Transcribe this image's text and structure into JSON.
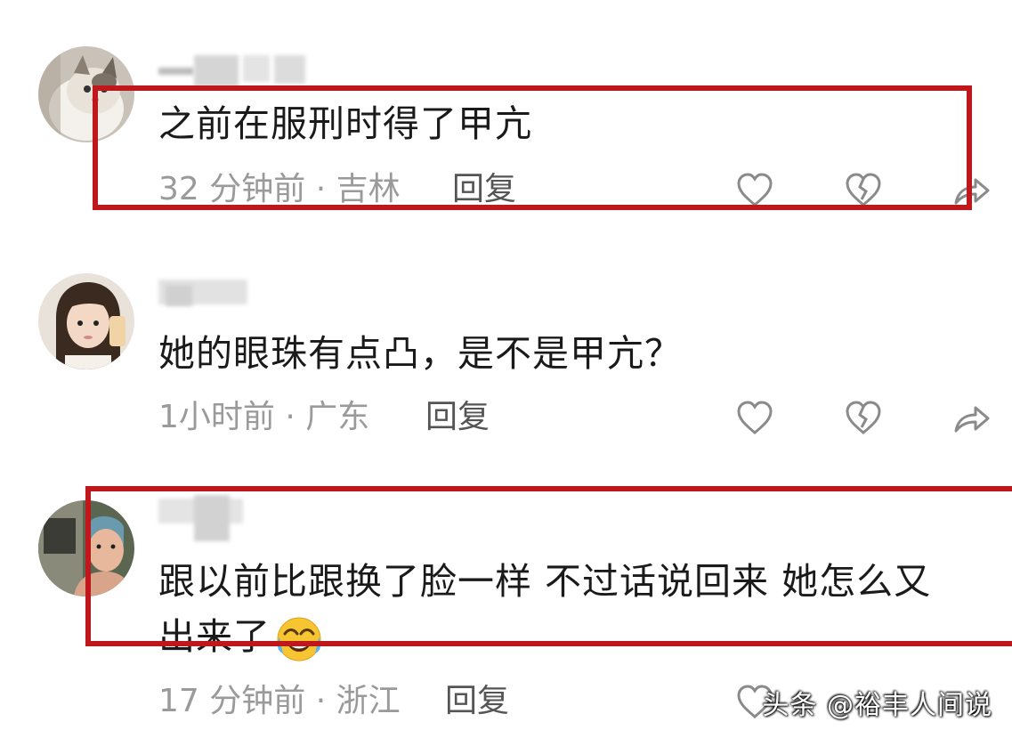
{
  "comments": [
    {
      "text": "之前在服刑时得了甲亢",
      "time_location": "32 分钟前 · 吉林",
      "reply_label": "回复"
    },
    {
      "text": "她的眼珠有点凸，是不是甲亢？",
      "time_location": "1小时前 · 广东",
      "reply_label": "回复"
    },
    {
      "text_line1": "跟以前比跟换了脸一样 不过话说回来 她怎么又",
      "text_line2": "出来了",
      "time_location": "17 分钟前 · 浙江",
      "reply_label": "回复"
    }
  ],
  "icons": {
    "like": "heart-icon",
    "dislike": "broken-heart-icon",
    "share": "share-arrow-icon",
    "emoji": "laughing-crying-emoji"
  },
  "watermark": "头条 @裕丰人间说",
  "colors": {
    "highlight_border": "#c0171c",
    "meta_gray": "#9a9a9a",
    "text_dark": "#1a1a1a"
  }
}
